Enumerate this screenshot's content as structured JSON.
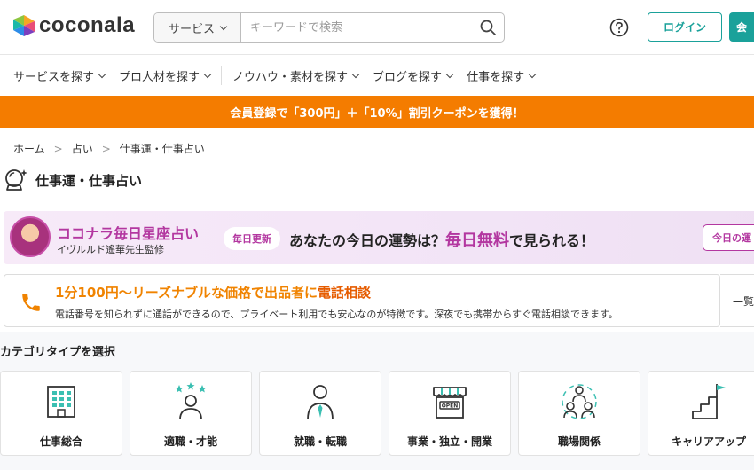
{
  "header": {
    "logo_text": "coconala",
    "search_category": "サービス",
    "search_placeholder": "キーワードで検索",
    "login_label": "ログイン",
    "register_label": "会"
  },
  "nav": {
    "items": [
      {
        "label": "サービスを探す"
      },
      {
        "label": "プロ人材を探す"
      },
      {
        "label": "ノウハウ・素材を探す"
      },
      {
        "label": "ブログを探す"
      },
      {
        "label": "仕事を探す"
      }
    ]
  },
  "promo": {
    "text": "会員登録で「300円」＋「10%」割引クーポンを獲得！"
  },
  "breadcrumb": {
    "items": [
      "ホーム",
      "占い",
      "仕事運・仕事占い"
    ],
    "separator": ">"
  },
  "page": {
    "title": "仕事運・仕事占い"
  },
  "horoscope_banner": {
    "title": "ココナラ毎日星座占い",
    "subtitle": "イヴルルド遙華先生監修",
    "badge": "毎日更新",
    "main_text_1": "あなたの今日の運勢は？",
    "main_text_em": "毎日無料",
    "main_text_2": "で見られる！",
    "cta": "今日の運"
  },
  "phone_consult": {
    "title_prefix": "1分100円〜リーズナブルな価格で出品者に",
    "title_highlight": "電話相談",
    "description": "電話番号を知られずに通話ができるので、プライベート利用でも安心なのが特徴です。深夜でも携帯からすぐ電話相談できます。",
    "side_label": "一覧"
  },
  "category_section": {
    "title": "カテゴリタイプを選択",
    "items": [
      {
        "label": "仕事総合",
        "icon": "building-icon"
      },
      {
        "label": "適職・才能",
        "icon": "person-stars-icon"
      },
      {
        "label": "就職・転職",
        "icon": "person-tie-icon"
      },
      {
        "label": "事業・独立・開業",
        "icon": "shop-open-icon"
      },
      {
        "label": "職場関係",
        "icon": "group-people-icon"
      },
      {
        "label": "キャリアアップ",
        "icon": "stairs-flag-icon"
      }
    ]
  },
  "colors": {
    "brand_teal": "#1aa19a",
    "promo_orange": "#f47c00",
    "horoscope_purple": "#b337a0",
    "phone_orange": "#f08300",
    "icon_teal": "#3bbfb2"
  }
}
